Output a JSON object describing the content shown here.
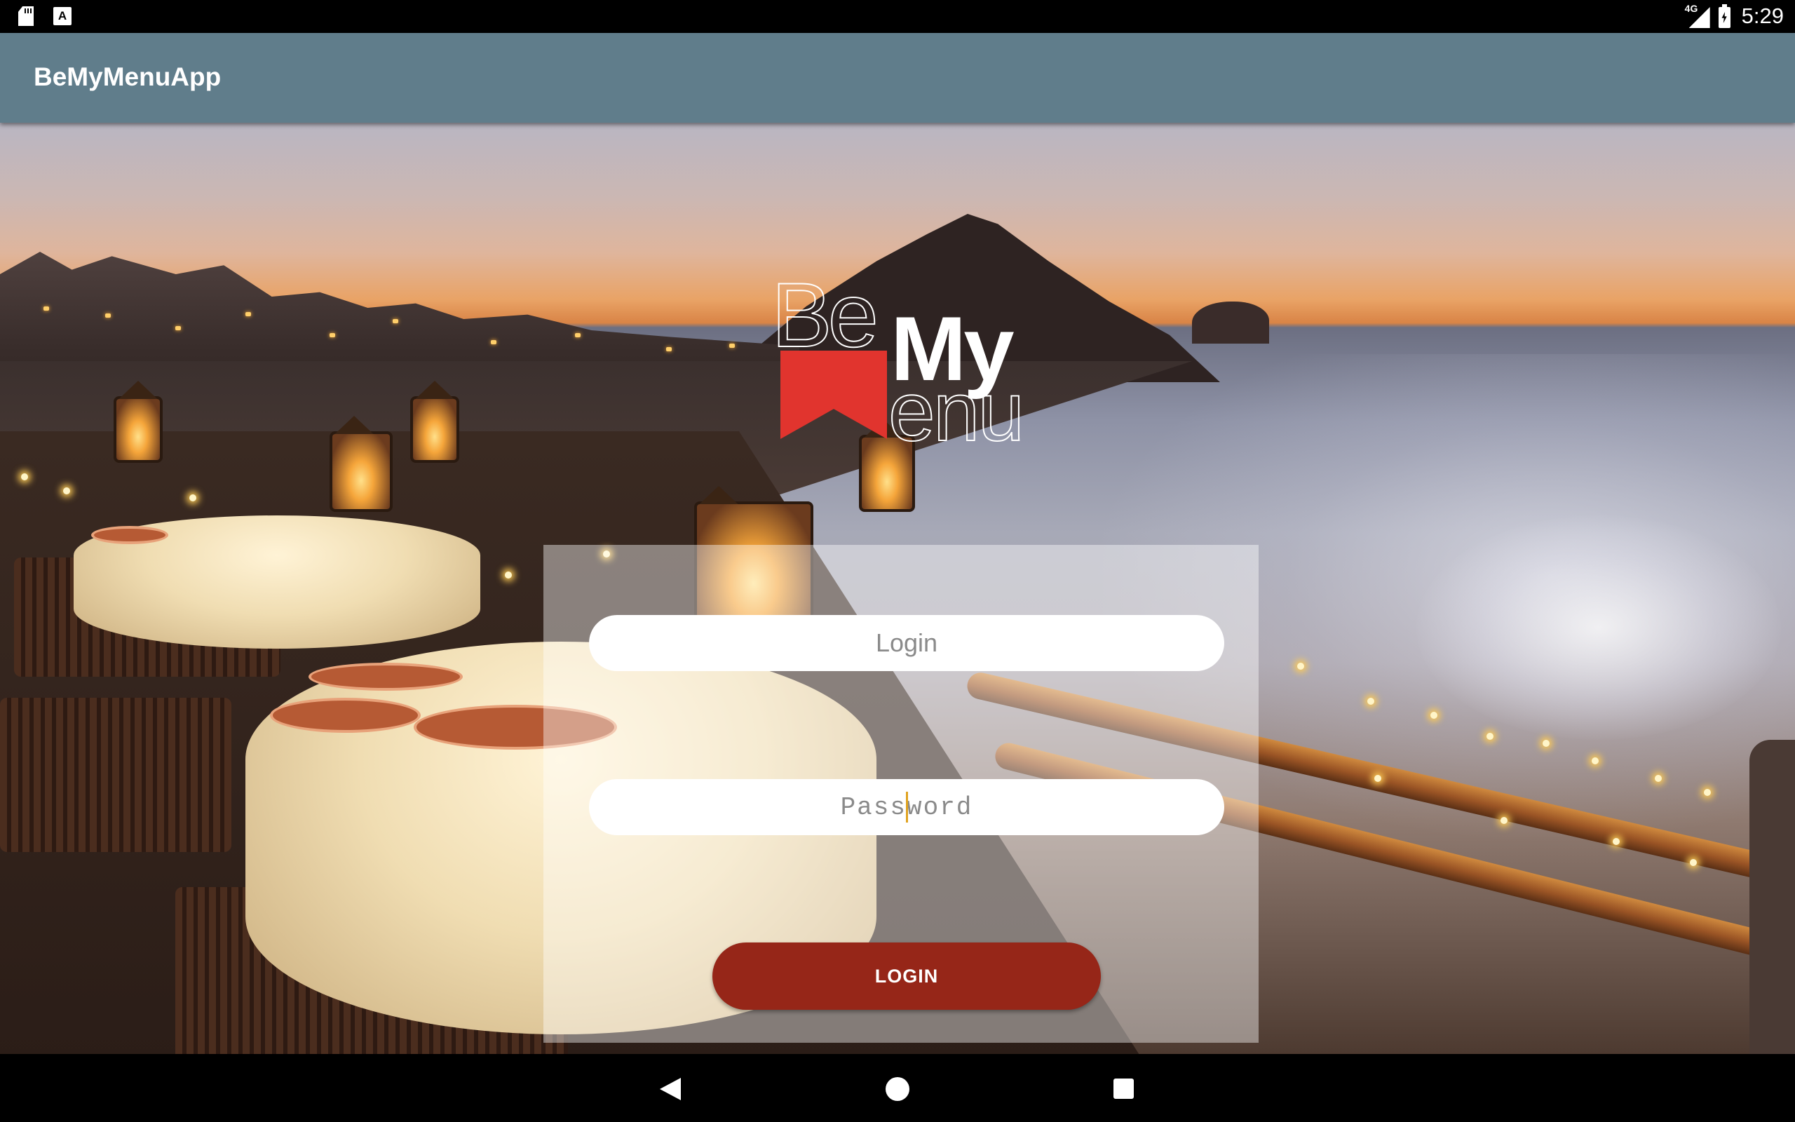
{
  "status_bar": {
    "network_type": "4G",
    "time": "5:29",
    "icons": [
      "sd-card-icon",
      "accessibility-a-icon",
      "signal-icon",
      "battery-charging-icon"
    ]
  },
  "app_bar": {
    "title": "BeMyMenuApp"
  },
  "logo": {
    "part_be": "Be",
    "part_my": "My",
    "part_enu": "enu",
    "brand_color": "#e1342e"
  },
  "login_form": {
    "login_placeholder": "Login",
    "login_value": "",
    "password_placeholder": "Password",
    "password_value": "",
    "submit_label": "LOGIN",
    "button_color": "#962618"
  },
  "nav_bar": {
    "icons": [
      "back-icon",
      "home-icon",
      "recents-icon"
    ]
  },
  "theme": {
    "app_bar_color": "#607d8b",
    "status_bar_color": "#000000"
  }
}
